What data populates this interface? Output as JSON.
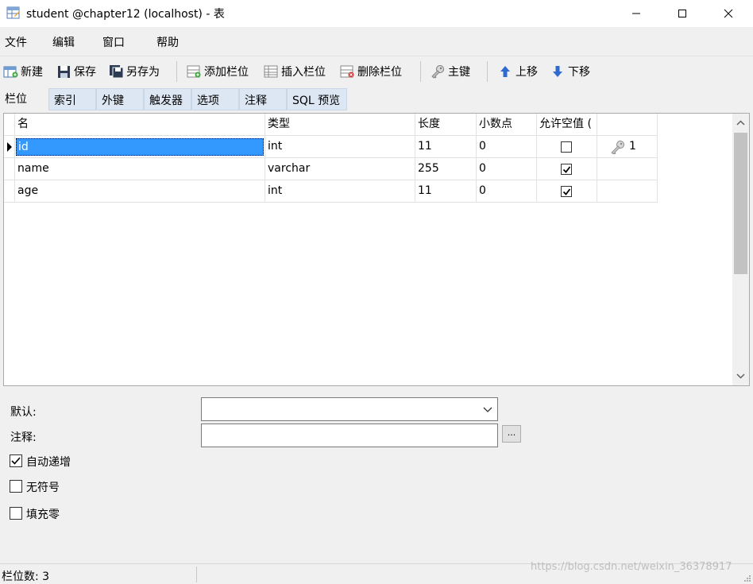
{
  "window": {
    "title": "student @chapter12 (localhost) - 表"
  },
  "menu": [
    "文件",
    "编辑",
    "窗口",
    "帮助"
  ],
  "toolbar": {
    "new": "新建",
    "save": "保存",
    "save_as": "另存为",
    "add_field": "添加栏位",
    "insert_field": "插入栏位",
    "delete_field": "删除栏位",
    "primary_key": "主键",
    "move_up": "上移",
    "move_down": "下移"
  },
  "tabs": [
    "栏位",
    "索引",
    "外键",
    "触发器",
    "选项",
    "注释",
    "SQL 预览"
  ],
  "grid": {
    "headers": [
      "名",
      "类型",
      "长度",
      "小数点",
      "允许空值 (",
      ""
    ],
    "rows": [
      {
        "name": "id",
        "type": "int",
        "length": "11",
        "decimals": "0",
        "nullable": false,
        "key": "1"
      },
      {
        "name": "name",
        "type": "varchar",
        "length": "255",
        "decimals": "0",
        "nullable": true,
        "key": ""
      },
      {
        "name": "age",
        "type": "int",
        "length": "11",
        "decimals": "0",
        "nullable": true,
        "key": ""
      }
    ]
  },
  "properties": {
    "default_label": "默认:",
    "default_value": "",
    "comment_label": "注释:",
    "comment_value": "",
    "ellipsis": "...",
    "auto_increment_label": "自动递增",
    "auto_increment": true,
    "unsigned_label": "无符号",
    "unsigned": false,
    "zerofill_label": "填充零",
    "zerofill": false
  },
  "status": {
    "field_count": "栏位数: 3"
  },
  "watermark": "https://blog.csdn.net/weixin_36378917",
  "colors": {
    "selection": "#3399ff",
    "tab_inactive": "#dde7f3"
  }
}
